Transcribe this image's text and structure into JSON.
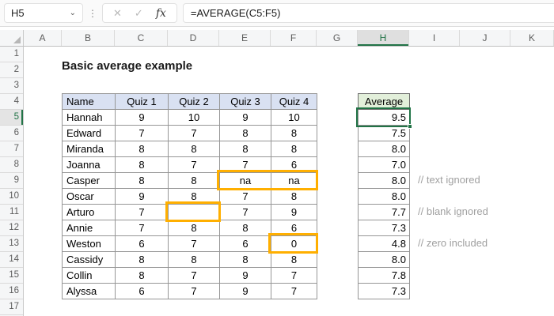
{
  "formula_bar": {
    "name_box_value": "H5",
    "formula": "=AVERAGE(C5:F5)"
  },
  "icons": {
    "chevron_down": "⌄",
    "more_dots": "⋮",
    "cancel": "✕",
    "enter": "✓",
    "insert_function": "fx"
  },
  "grid": {
    "column_letters": [
      "A",
      "B",
      "C",
      "D",
      "E",
      "F",
      "G",
      "H",
      "I",
      "J",
      "K"
    ],
    "row_numbers": [
      "1",
      "2",
      "3",
      "4",
      "5",
      "6",
      "7",
      "8",
      "9",
      "10",
      "11",
      "12",
      "13",
      "14",
      "15",
      "16",
      "17"
    ],
    "selected_column": "H",
    "selected_row": "5"
  },
  "sheet": {
    "title": "Basic average example",
    "selected_cell": "H5",
    "table": {
      "headers": [
        "Name",
        "Quiz 1",
        "Quiz 2",
        "Quiz 3",
        "Quiz 4"
      ],
      "rows": [
        {
          "name": "Hannah",
          "scores": [
            "9",
            "10",
            "9",
            "10"
          ]
        },
        {
          "name": "Edward",
          "scores": [
            "7",
            "7",
            "8",
            "8"
          ]
        },
        {
          "name": "Miranda",
          "scores": [
            "8",
            "8",
            "8",
            "8"
          ]
        },
        {
          "name": "Joanna",
          "scores": [
            "8",
            "7",
            "7",
            "6"
          ]
        },
        {
          "name": "Casper",
          "scores": [
            "8",
            "8",
            "na",
            "na"
          ]
        },
        {
          "name": "Oscar",
          "scores": [
            "9",
            "8",
            "7",
            "8"
          ]
        },
        {
          "name": "Arturo",
          "scores": [
            "7",
            "",
            "7",
            "9"
          ]
        },
        {
          "name": "Annie",
          "scores": [
            "7",
            "8",
            "8",
            "6"
          ]
        },
        {
          "name": "Weston",
          "scores": [
            "6",
            "7",
            "6",
            "0"
          ]
        },
        {
          "name": "Cassidy",
          "scores": [
            "8",
            "8",
            "8",
            "8"
          ]
        },
        {
          "name": "Collin",
          "scores": [
            "8",
            "7",
            "9",
            "7"
          ]
        },
        {
          "name": "Alyssa",
          "scores": [
            "6",
            "7",
            "9",
            "7"
          ]
        }
      ]
    },
    "average_column": {
      "header": "Average",
      "values": [
        "9.5",
        "7.5",
        "8.0",
        "7.0",
        "8.0",
        "8.0",
        "7.7",
        "7.3",
        "4.8",
        "8.0",
        "7.8",
        "7.3"
      ]
    },
    "annotations": [
      {
        "row": 9,
        "text": "// text ignored"
      },
      {
        "row": 11,
        "text": "// blank ignored"
      },
      {
        "row": 13,
        "text": "// zero included"
      }
    ]
  },
  "colors": {
    "accent_green": "#217346",
    "table_header_blue": "#D9E1F2",
    "average_header_green": "#E2EFDA",
    "highlight_orange": "#FFAF00",
    "annotation_gray": "#A0A0A0"
  }
}
